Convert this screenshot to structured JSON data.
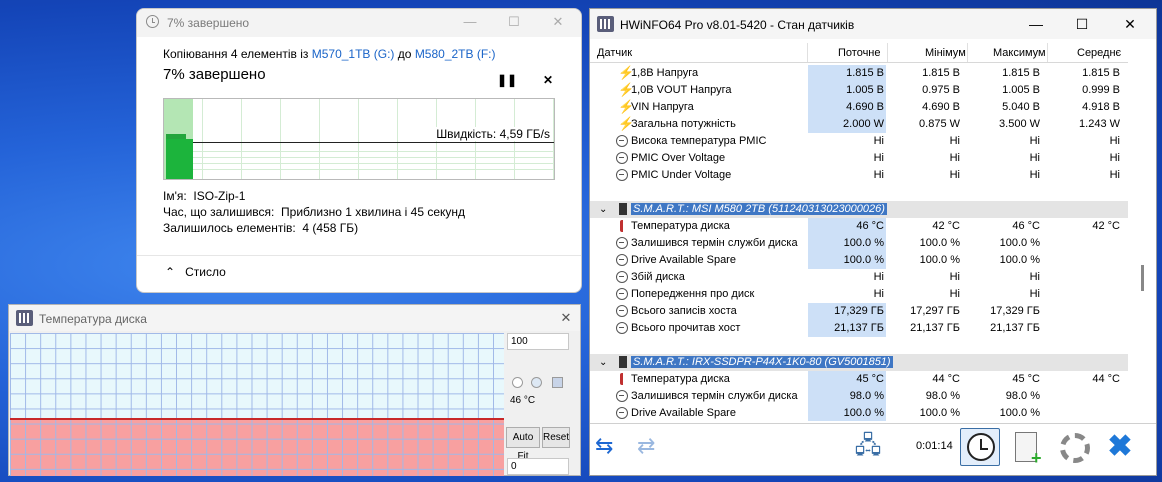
{
  "copy_dialog": {
    "title": "7% завершено",
    "copy_line_prefix": "Копіювання 4 елементів із",
    "source": "M570_1TB (G:)",
    "to": "до",
    "dest": "M580_2TB (F:)",
    "progress_text": "7% завершено",
    "progress_fraction": 0.07,
    "pause_icon": "pause-icon",
    "cancel_icon": "close-icon",
    "speed": "Швидкість: 4,59 ГБ/s",
    "name_label": "Ім'я:",
    "name_value": "ISO-Zip-1",
    "time_label": "Час, що залишився:",
    "time_value": "Приблизно 1 хвилина і 45 секунд",
    "items_label": "Залишилось елементів:",
    "items_value": "4 (458 ГБ)",
    "less": "Стисло"
  },
  "temp_window": {
    "title": "Температура диска",
    "max_value": "100",
    "current_value": "46 °C",
    "min_value": "0",
    "autofit": "Auto Fit",
    "reset": "Reset",
    "red_color": "#f8a0a0",
    "bg_color": "#e8f8fc"
  },
  "hwinfo": {
    "title": "HWiNFO64 Pro v8.01-5420 - Стан датчиків",
    "headers": {
      "sensor": "Датчик",
      "current": "Поточне",
      "min": "Мінімум",
      "max": "Максимум",
      "avg": "Середнє"
    },
    "rows": [
      {
        "icon": "bolt",
        "label": "1,8В Напруга",
        "cur": "1.815 В",
        "min": "1.815 В",
        "max": "1.815 В",
        "avg": "1.815 В"
      },
      {
        "icon": "bolt",
        "label": "1,0В VOUT Напруга",
        "cur": "1.005 В",
        "min": "0.975 В",
        "max": "1.005 В",
        "avg": "0.999 В"
      },
      {
        "icon": "bolt",
        "label": "VIN Напруга",
        "cur": "4.690 В",
        "min": "4.690 В",
        "max": "5.040 В",
        "avg": "4.918 В"
      },
      {
        "icon": "bolt",
        "label": "Загальна потужність",
        "cur": "2.000 W",
        "min": "0.875 W",
        "max": "3.500 W",
        "avg": "1.243 W"
      },
      {
        "icon": "circle",
        "label": "Висока температура PMIC",
        "cur": "Ні",
        "min": "Ні",
        "max": "Ні",
        "avg": "Ні"
      },
      {
        "icon": "circle",
        "label": "PMIC Over Voltage",
        "cur": "Ні",
        "min": "Ні",
        "max": "Ні",
        "avg": "Ні"
      },
      {
        "icon": "circle",
        "label": "PMIC Under Voltage",
        "cur": "Ні",
        "min": "Ні",
        "max": "Ні",
        "avg": "Ні"
      },
      {
        "icon": "blank",
        "label": "",
        "cur": "",
        "min": "",
        "max": "",
        "avg": ""
      },
      {
        "icon": "section",
        "label": "S.M.A.R.T.: MSI M580 2TB (511240313023000026)",
        "cur": "",
        "min": "",
        "max": "",
        "avg": ""
      },
      {
        "icon": "therm",
        "label": "Температура диска",
        "cur": "46 °C",
        "min": "42 °C",
        "max": "46 °C",
        "avg": "42 °C"
      },
      {
        "icon": "circle",
        "label": "Залишився термін служби диска",
        "cur": "100.0 %",
        "min": "100.0 %",
        "max": "100.0 %",
        "avg": ""
      },
      {
        "icon": "circle",
        "label": "Drive Available Spare",
        "cur": "100.0 %",
        "min": "100.0 %",
        "max": "100.0 %",
        "avg": ""
      },
      {
        "icon": "circle",
        "label": "Збій диска",
        "cur": "Ні",
        "min": "Ні",
        "max": "Ні",
        "avg": ""
      },
      {
        "icon": "circle",
        "label": "Попередження про диск",
        "cur": "Ні",
        "min": "Ні",
        "max": "Ні",
        "avg": ""
      },
      {
        "icon": "circle",
        "label": "Всього записів хоста",
        "cur": "17,329 ГБ",
        "min": "17,297 ГБ",
        "max": "17,329 ГБ",
        "avg": ""
      },
      {
        "icon": "circle",
        "label": "Всього прочитав хост",
        "cur": "21,137 ГБ",
        "min": "21,137 ГБ",
        "max": "21,137 ГБ",
        "avg": ""
      },
      {
        "icon": "blank",
        "label": "",
        "cur": "",
        "min": "",
        "max": "",
        "avg": ""
      },
      {
        "icon": "section",
        "label": "S.M.A.R.T.: IRX-SSDPR-P44X-1K0-80 (GV5001851)",
        "cur": "",
        "min": "",
        "max": "",
        "avg": ""
      },
      {
        "icon": "therm",
        "label": "Температура диска",
        "cur": "45 °C",
        "min": "44 °C",
        "max": "45 °C",
        "avg": "44 °C"
      },
      {
        "icon": "circle",
        "label": "Залишився термін служби диска",
        "cur": "98.0 %",
        "min": "98.0 %",
        "max": "98.0 %",
        "avg": ""
      },
      {
        "icon": "circle",
        "label": "Drive Available Spare",
        "cur": "100.0 %",
        "min": "100.0 %",
        "max": "100.0 %",
        "avg": ""
      }
    ],
    "timer": "0:01:14",
    "highlight_color": "#cde0f7"
  }
}
